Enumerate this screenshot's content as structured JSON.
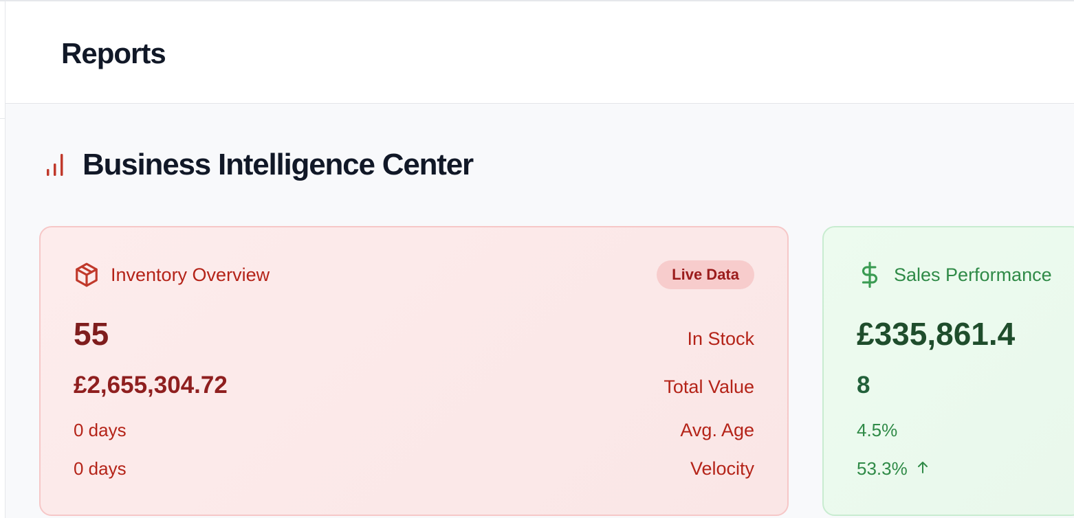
{
  "header": {
    "title": "Reports"
  },
  "section": {
    "title": "Business Intelligence Center",
    "icon": "bar-chart-icon"
  },
  "inventory_card": {
    "title": "Inventory Overview",
    "icon": "package-icon",
    "badge": "Live Data",
    "accent": "#b42318",
    "rows": [
      {
        "value": "55",
        "label": "In Stock"
      },
      {
        "value": "£2,655,304.72",
        "label": "Total Value"
      },
      {
        "value": "0 days",
        "label": "Avg. Age"
      },
      {
        "value": "0 days",
        "label": "Velocity"
      }
    ]
  },
  "sales_card": {
    "title": "Sales Performance",
    "icon": "dollar-icon",
    "accent": "#2f8a47",
    "rows": [
      {
        "value": "£335,861.4"
      },
      {
        "value": "8"
      },
      {
        "value": "4.5%"
      },
      {
        "value": "53.3%",
        "trend_icon": "arrow-up-icon"
      }
    ]
  }
}
